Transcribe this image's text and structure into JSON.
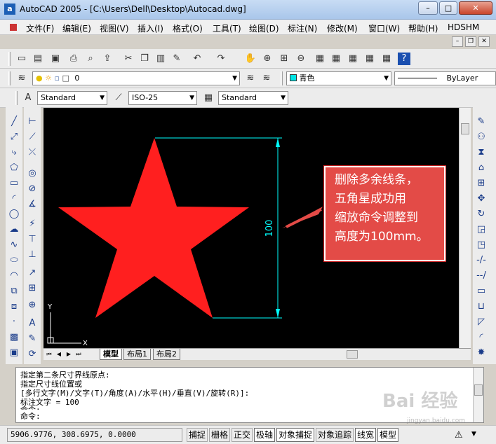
{
  "window": {
    "title": "AutoCAD 2005 - [C:\\Users\\Dell\\Desktop\\Autocad.dwg]",
    "app_icon": "a",
    "minimize": "–",
    "maximize": "□",
    "close": "✕"
  },
  "menu": {
    "items": [
      "文件(F)",
      "编辑(E)",
      "视图(V)",
      "插入(I)",
      "格式(O)",
      "工具(T)",
      "绘图(D)",
      "标注(N)",
      "修改(M)",
      "窗口(W)",
      "帮助(H)",
      "HDSHM"
    ],
    "mdi_min": "–",
    "mdi_restore": "❐",
    "mdi_close": "✕"
  },
  "layers": {
    "layer_value": "0",
    "color_value": "青色",
    "linetype_value": "ByLayer"
  },
  "styles": {
    "text_style": "Standard",
    "dim_style": "ISO-25",
    "table_style": "Standard"
  },
  "drawing": {
    "dimension_text": "100",
    "ucs_y": "Y",
    "ucs_x": "X",
    "star_color": "#ff1f1f",
    "dim_color": "#00ffff"
  },
  "annotation": {
    "lines": [
      "删除多余线条，",
      "五角星成功用",
      "缩放命令调整到",
      "高度为100mm。"
    ]
  },
  "tabs": {
    "items": [
      "模型",
      "布局1",
      "布局2"
    ],
    "active_index": 0
  },
  "command": {
    "lines": [
      "指定第二条尺寸界线原点:",
      "指定尺寸线位置或",
      "[多行文字(M)/文字(T)/角度(A)/水平(H)/垂直(V)/旋转(R)]:",
      "标注文字 = 100",
      "命令:",
      "命令:"
    ]
  },
  "status": {
    "coordinates": "5906.9776, 308.6975, 0.0000",
    "buttons": [
      {
        "label": "捕捉",
        "on": false
      },
      {
        "label": "栅格",
        "on": false
      },
      {
        "label": "正交",
        "on": false
      },
      {
        "label": "极轴",
        "on": true
      },
      {
        "label": "对象捕捉",
        "on": true
      },
      {
        "label": "对象追踪",
        "on": false
      },
      {
        "label": "线宽",
        "on": true
      },
      {
        "label": "模型",
        "on": true
      }
    ]
  },
  "watermark": {
    "text": "Bai 经验",
    "url": "jingyan.baidu.com"
  }
}
